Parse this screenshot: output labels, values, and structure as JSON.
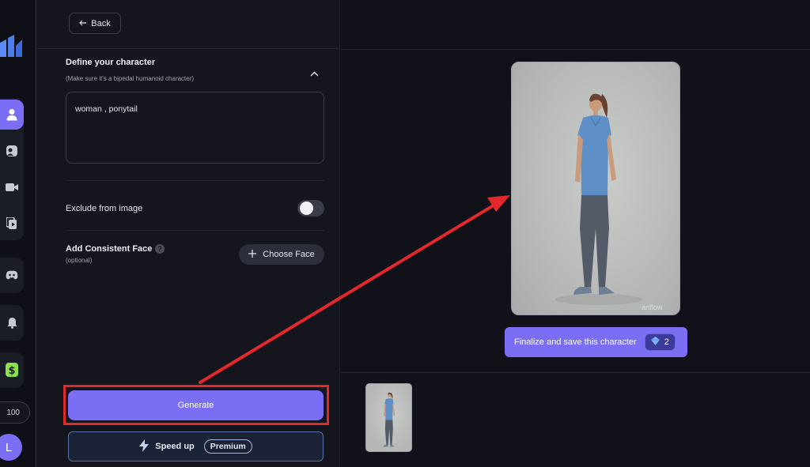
{
  "sidebar": {
    "credits": "100",
    "avatar_initial": "L",
    "items": [
      "user-icon",
      "character-icon",
      "video-camera-icon",
      "media-play-icon",
      "discord-icon",
      "bell-icon",
      "dollar-icon"
    ]
  },
  "panel": {
    "back_label": "Back",
    "section_title": "Define your character",
    "section_subtitle": "(Make sure it's a bipedal humanoid character)",
    "prompt_value": "woman , ponytail",
    "exclude_label": "Exclude from image",
    "exclude_enabled": false,
    "face_label": "Add Consistent Face",
    "face_sublabel": "(optional)",
    "choose_face_label": "Choose Face",
    "generate_label": "Generate",
    "speed_label": "Speed up",
    "premium_label": "Premium"
  },
  "preview": {
    "finalize_label": "Finalize and save this character",
    "finalize_cost": "2",
    "watermark": "artflow"
  },
  "colors": {
    "accent": "#7b6ef5",
    "highlight": "#e3282b",
    "background": "#111219"
  }
}
